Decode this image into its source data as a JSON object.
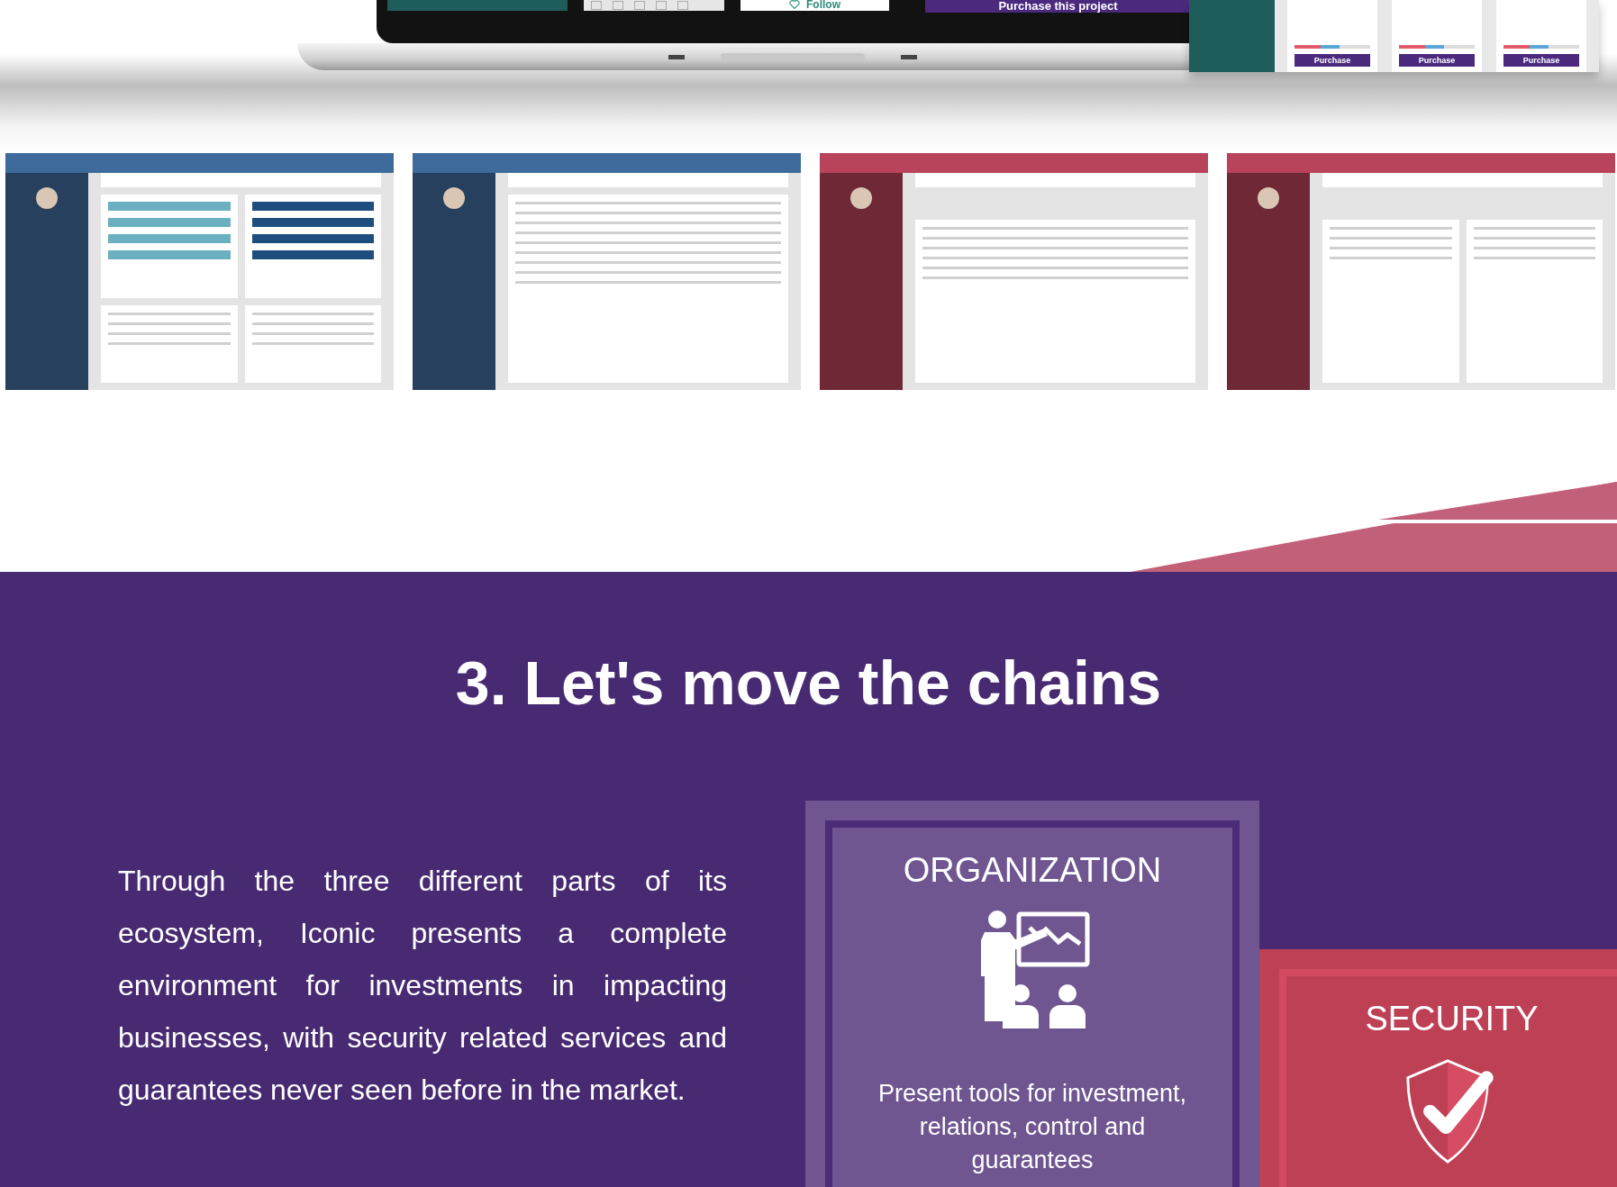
{
  "showcase": {
    "follow_button": "Follow",
    "purchase_button": "Purchase this project",
    "tablet_cards": [
      {
        "button": "Purchase"
      },
      {
        "button": "Purchase"
      },
      {
        "button": "Purchase"
      }
    ]
  },
  "thumbnails": [
    {
      "kind": "charts",
      "color": "#3f6a9c"
    },
    {
      "kind": "table",
      "color": "#3f6a9c"
    },
    {
      "kind": "detail",
      "color": "#b8435a"
    },
    {
      "kind": "list",
      "color": "#b8435a"
    }
  ],
  "section": {
    "title": "3. Let's move the chains",
    "paragraph": "Through the three different parts of its ecosystem, Iconic presents a complete environment for investments in impacting businesses, with security related services and guarantees never seen before in the market.",
    "cards": [
      {
        "kind": "organization",
        "title": "ORGANIZATION",
        "text": "Present tools for investment, relations, control and guarantees"
      },
      {
        "kind": "security",
        "title": "SECURITY"
      }
    ]
  }
}
